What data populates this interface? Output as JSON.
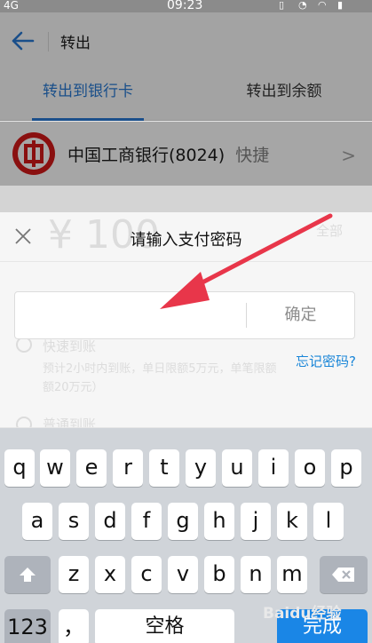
{
  "status_bar": {
    "signal": "4G",
    "time": "09:23"
  },
  "nav": {
    "title": "转出"
  },
  "tabs": [
    {
      "label": "转出到银行卡",
      "active": true
    },
    {
      "label": "转出到余额",
      "active": false
    }
  ],
  "bank": {
    "name": "中国工商银行(8024)",
    "tag": "快捷"
  },
  "background_hints": {
    "amount": "¥ 100",
    "all_label": "全部",
    "fast_label": "快速到账",
    "fast_desc_1": "预计2小时内到账，单日限额5万元，单笔限额",
    "fast_desc_2": "额20万元）",
    "normal_label": "普通到账"
  },
  "dialog": {
    "title": "请输入支付密码",
    "password_value": "",
    "confirm_label": "确定",
    "forgot_label": "忘记密码?"
  },
  "keyboard": {
    "row1": [
      "q",
      "w",
      "e",
      "r",
      "t",
      "y",
      "u",
      "i",
      "o",
      "p"
    ],
    "row2": [
      "a",
      "s",
      "d",
      "f",
      "g",
      "h",
      "j",
      "k",
      "l"
    ],
    "row3": [
      "z",
      "x",
      "c",
      "v",
      "b",
      "n",
      "m"
    ],
    "numbers_label": "123",
    "comma_label": "，",
    "space_label": "空格",
    "enter_label": "完成"
  },
  "watermark": "Baidu经验",
  "colors": {
    "accent": "#1a86d8",
    "annotation_arrow": "#e8364a",
    "bank_red": "#8a1010"
  }
}
